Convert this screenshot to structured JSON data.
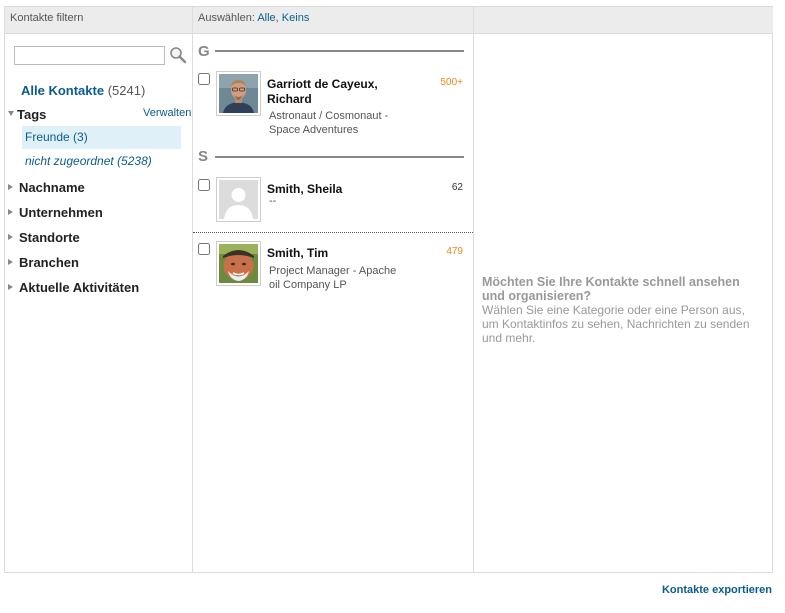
{
  "header": {
    "filter_label": "Kontakte filtern",
    "select_prefix": "Auswählen:",
    "select_all": "Alle",
    "select_sep": ",",
    "select_none": "Keins"
  },
  "sidebar": {
    "all_contacts_label": "Alle Kontakte",
    "all_contacts_count": "(5241)",
    "tags_label": "Tags",
    "manage_label": "Verwalten",
    "tags": [
      {
        "label": "Freunde (3)"
      },
      {
        "label": "nicht zugeordnet (5238)"
      }
    ],
    "sections": [
      {
        "label": "Nachname"
      },
      {
        "label": "Unternehmen"
      },
      {
        "label": "Standorte"
      },
      {
        "label": "Branchen"
      },
      {
        "label": "Aktuelle Aktivitäten"
      }
    ]
  },
  "groups": [
    {
      "letter": "G"
    },
    {
      "letter": "S"
    }
  ],
  "contacts": [
    {
      "name": "Garriott de Cayeux, Richard",
      "title": "Astronaut / Cosmonaut - Space Adventures",
      "connections": "500+",
      "num_color": "#e8891a",
      "photo": "man-portrait-icon"
    },
    {
      "name": "Smith, Sheila",
      "title": "--",
      "connections": "62",
      "num_color": "#333333",
      "photo": "default-avatar-icon"
    },
    {
      "name": "Smith, Tim",
      "title": "Project Manager - Apache oil Company LP",
      "connections": "479",
      "num_color": "#e8891a",
      "photo": "man-outdoor-portrait-icon"
    }
  ],
  "detail": {
    "heading": "Möchten Sie Ihre Kontakte schnell ansehen und organisieren?",
    "body": "Wählen Sie eine Kategorie oder eine Person aus, um Kontaktinfos zu sehen, Nachrichten zu senden und mehr."
  },
  "footer": {
    "export_label": "Kontakte exportieren"
  },
  "colors": {
    "link": "#0b5c8e",
    "accent_orange": "#e8891a",
    "selected_bg": "#dff0f8"
  }
}
